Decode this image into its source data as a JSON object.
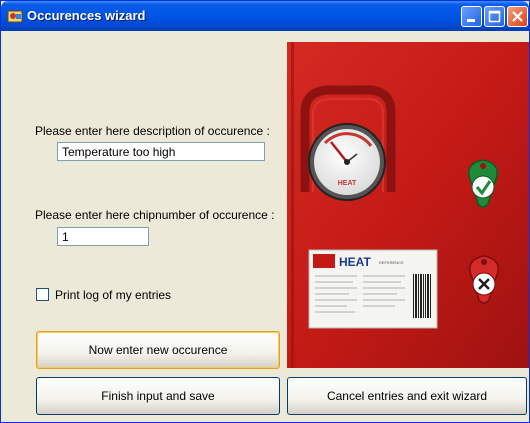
{
  "window": {
    "title": "Occurences wizard"
  },
  "form": {
    "description_label": "Please enter here description of occurence :",
    "description_value": "Temperature too high",
    "chip_label": "Please enter here chipnumber of occurence :",
    "chip_value": "1",
    "print_label": "Print log of my entries",
    "print_checked": false
  },
  "buttons": {
    "new": "Now enter new occurence",
    "finish": "Finish input and save",
    "cancel": "Cancel entries and exit wizard"
  },
  "photo": {
    "gauge_brand": "HEAT",
    "plate_brand": "HEAT",
    "plate_sub": "REFERENCE"
  },
  "colors": {
    "title_bar": "#0055e5",
    "panel": "#ece9d8",
    "photo_red": "#c41a16",
    "tag_green": "#1f8a3a",
    "tag_red": "#d42a2a"
  },
  "icons": [
    "app-icon",
    "minimize-icon",
    "maximize-icon",
    "close-icon",
    "checkmark-icon",
    "x-icon"
  ]
}
